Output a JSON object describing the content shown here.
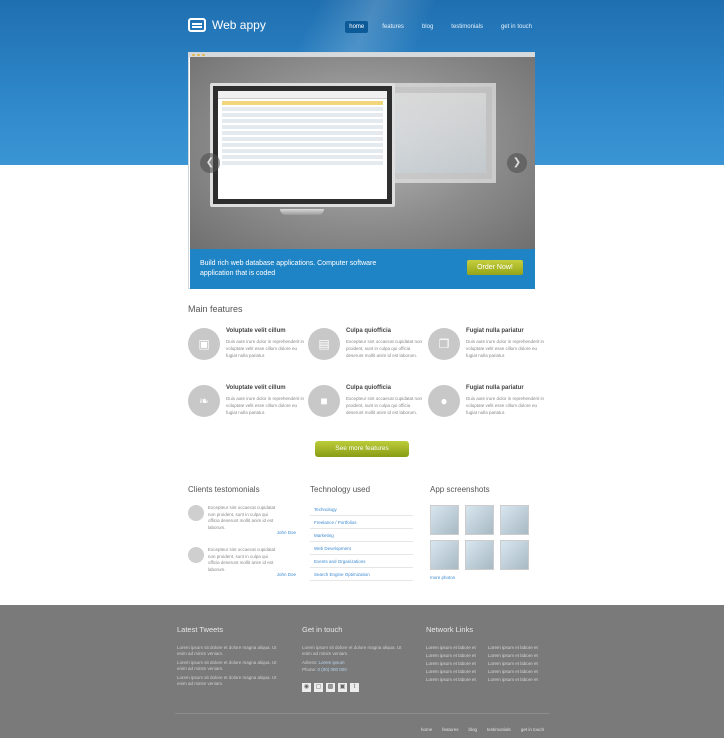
{
  "header": {
    "logo_text": "Web appy",
    "nav": [
      "home",
      "features",
      "blog",
      "testimonials",
      "get in touch"
    ],
    "active_nav": "home"
  },
  "slider": {
    "caption": "Build rich web database applications. Computer software application that is coded",
    "cta_label": "Order Now!"
  },
  "features": {
    "title": "Main features",
    "items": [
      {
        "title": "Voluptate velit cillum",
        "text": "Duis aute irure dolor in reprehenderit in voluptate velit esse cillum dolore eu fugiat nulla pariatur.",
        "icon": "presentation-icon"
      },
      {
        "title": "Culpa quiofficia",
        "text": "Excepteur sint occaecat cupidatat non proident, sunt in culpa qui officia deserunt mollit anim id est laborum.",
        "icon": "cart-icon"
      },
      {
        "title": "Fugiat nulla pariatur",
        "text": "Duis aute irure dolor in reprehenderit in voluptate velit esse cillum dolore eu fugiat nulla pariatur.",
        "icon": "documents-icon"
      },
      {
        "title": "Voluptate velit cillum",
        "text": "Duis aute irure dolor in reprehenderit in voluptate velit esse cillum dolore eu fugiat nulla pariatur.",
        "icon": "twitter-icon"
      },
      {
        "title": "Culpa quiofficia",
        "text": "Excepteur sint occaecat cupidatat non proident, sunt in culpa qui officia deserunt mollit anim id est laborum.",
        "icon": "lock-icon"
      },
      {
        "title": "Fugiat nulla pariatur",
        "text": "Duis aute irure dolor in reprehenderit in voluptate velit esse cillum dolore eu fugiat nulla pariatur.",
        "icon": "users-icon"
      }
    ],
    "more_label": "See more features"
  },
  "testimonials": {
    "title": "Clients testomonials",
    "items": [
      {
        "text": "Excepteur sint occaecat cupidatat non proident, sunt in culpa qui officia deserunt mollit anim id est laborum.",
        "author": "John Doe"
      },
      {
        "text": "Excepteur sint occaecat cupidatat non proident, sunt in culpa qui officia deserunt mollit anim id est laborum.",
        "author": "John Doe"
      }
    ]
  },
  "technology": {
    "title": "Technology used",
    "items": [
      "Technology",
      "Freelance / Portfolios",
      "Marketing",
      "Web Development",
      "Events and Organizations",
      "Search Engine Optimization"
    ]
  },
  "screenshots": {
    "title": "App screenshots",
    "more_label": "more photos"
  },
  "footer": {
    "tweets_title": "Latest Tweets",
    "tweets": [
      "Lorem ipsum sit dolore et dolore magna aliqua. Ut enim ad minim veniam.",
      "Lorem ipsum sit dolore et dolore magna aliqua. Ut enim ad minim veniam.",
      "Lorem ipsum sit dolore et dolore magna aliqua. Ut enim ad minim veniam."
    ],
    "contact_title": "Get in touch",
    "contact_text": "Lorem ipsum sit dolore et dolore magna aliqua. Ut enim ad minim veniam.",
    "address_label": "Adress:",
    "address_value": "Lorem ipsum",
    "phone_label": "Phone:",
    "phone_value": "0 (00) 000 000",
    "links_title": "Network Links",
    "links": [
      "Lorem ipsum et labore et",
      "Lorem ipsum et labore et",
      "Lorem ipsum et labore et",
      "Lorem ipsum et labore et",
      "Lorem ipsum et labore et",
      "Lorem ipsum et labore et",
      "Lorem ipsum et labore et",
      "Lorem ipsum et labore et",
      "Lorem ipsum et labore et",
      "Lorem ipsum et labore et"
    ],
    "bottom_nav": [
      "home",
      "features",
      "blog",
      "testimonials",
      "get in touch"
    ]
  }
}
